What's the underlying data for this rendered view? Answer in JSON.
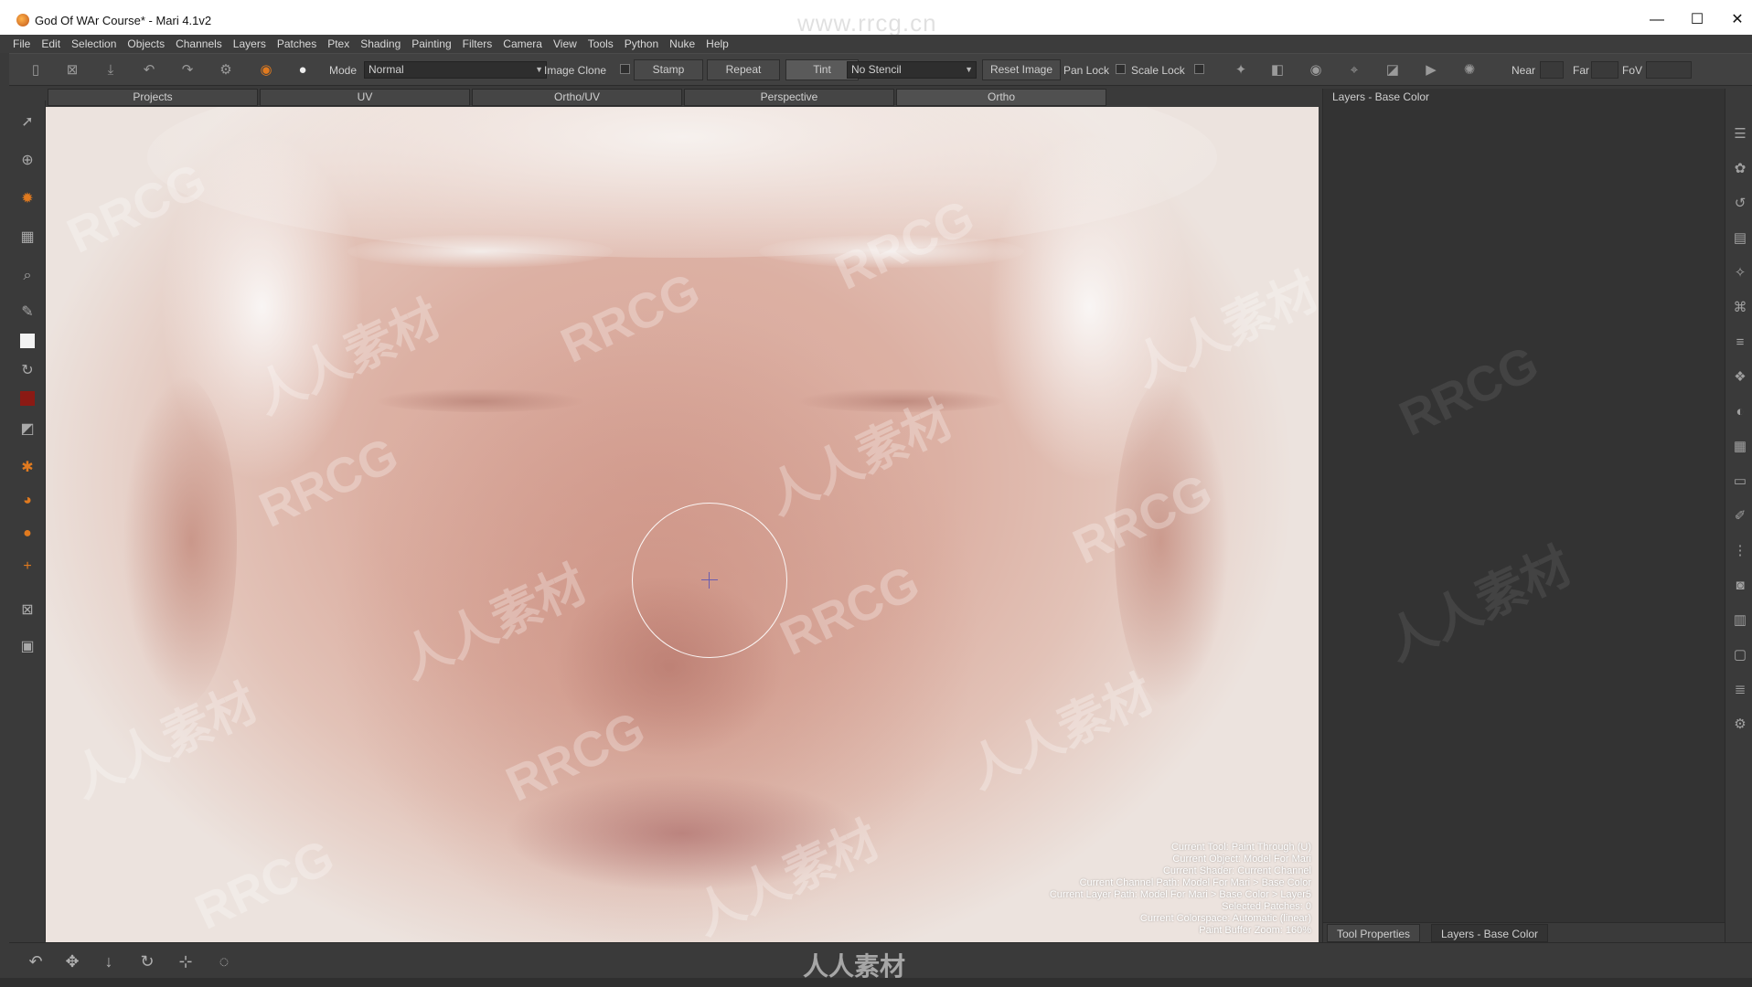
{
  "window": {
    "title": "God Of WAr Course* - Mari 4.1v2",
    "watermark_url": "www.rrcg.cn",
    "minimize_glyph": "—",
    "maximize_glyph": "☐",
    "close_glyph": "✕"
  },
  "menubar": {
    "items": [
      "File",
      "Edit",
      "Selection",
      "Objects",
      "Channels",
      "Layers",
      "Patches",
      "Ptex",
      "Shading",
      "Painting",
      "Filters",
      "Camera",
      "View",
      "Tools",
      "Python",
      "Nuke",
      "Help"
    ]
  },
  "toolbar": {
    "mode_label": "Mode",
    "mode_value": "Normal",
    "image_clone_label": "Image Clone",
    "stamp_label": "Stamp",
    "repeat_label": "Repeat",
    "tint_label": "Tint",
    "stencil_value": "No Stencil",
    "reset_image_label": "Reset Image",
    "pan_lock_label": "Pan Lock",
    "scale_lock_label": "Scale Lock",
    "near_label": "Near",
    "far_label": "Far",
    "fov_label": "FoV"
  },
  "view_tabs": [
    "Projects",
    "UV",
    "Ortho/UV",
    "Perspective",
    "Ortho"
  ],
  "hud": {
    "lines": [
      "Current Tool: Paint Through (U)",
      "Current Object: Model For Mari",
      "Current Shader: Current Channel",
      "Current Channel Path: Model For Mari > Base Color",
      "Current Layer Path: Model For Mari > Base Color > Layer5",
      "Selected Patches: 0",
      "Current Colorspace: Automatic (linear)",
      "Paint Buffer Zoom: 160%"
    ]
  },
  "right_panel": {
    "header": "Layers - Base Color",
    "tabs": [
      "Tool Properties",
      "Layers - Base Color"
    ]
  },
  "watermarks": {
    "latin": "RRCG",
    "cjk": "人人素材",
    "bottom_logo": "人人素材"
  },
  "colors": {
    "accent_orange": "#e07a1f",
    "paint_color": "#8b1a14",
    "panel_bg": "#333333",
    "viewport_bg": "#e8dcd6"
  },
  "icons": {
    "left_toolbar": [
      "select-arrow-icon",
      "transform-icon",
      "paint-brush-icon",
      "layers-grid-icon",
      "zoom-icon",
      "eyedropper-icon",
      "color-swatch-white-icon",
      "refresh-icon",
      "color-swatch-red-icon",
      "color-swap-icon",
      "paint-through-icon",
      "bucket-icon",
      "sphere-icon",
      "add-point-icon",
      "mask-icon",
      "frame-icon"
    ],
    "bottom_toolbar": [
      "undo-icon",
      "move-icon",
      "arrow-down-icon",
      "rotate-icon",
      "scale-icon",
      "lasso-icon"
    ]
  }
}
